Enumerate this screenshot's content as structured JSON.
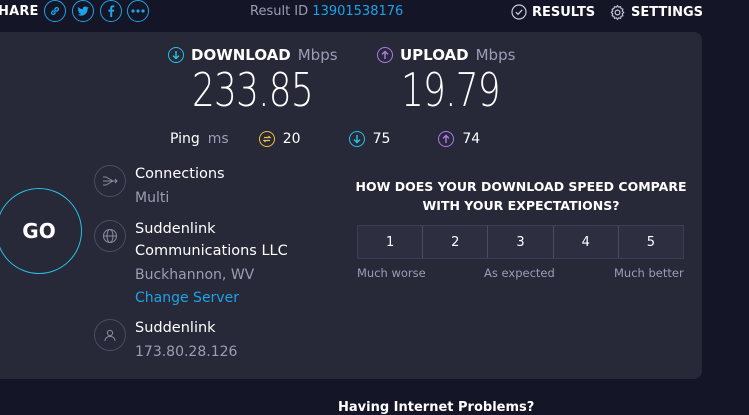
{
  "header": {
    "share_label": "HARE",
    "result_id_label": "Result ID",
    "result_id_value": "13901538176",
    "results_label": "RESULTS",
    "settings_label": "SETTINGS"
  },
  "download": {
    "label": "DOWNLOAD",
    "unit": "Mbps",
    "value": "233.85"
  },
  "upload": {
    "label": "UPLOAD",
    "unit": "Mbps",
    "value": "19.79"
  },
  "ping": {
    "label": "Ping",
    "unit": "ms",
    "idle": "20",
    "download": "75",
    "upload": "74"
  },
  "go_label": "GO",
  "connections": {
    "title": "Connections",
    "value": "Multi"
  },
  "server": {
    "name_line1": "Suddenlink",
    "name_line2": "Communications LLC",
    "location": "Buckhannon, WV",
    "change_link": "Change Server"
  },
  "isp": {
    "name": "Suddenlink",
    "ip": "173.80.28.126"
  },
  "survey": {
    "question_line1": "HOW DOES YOUR DOWNLOAD SPEED COMPARE",
    "question_line2": "WITH YOUR EXPECTATIONS?",
    "options": [
      "1",
      "2",
      "3",
      "4",
      "5"
    ],
    "low_label": "Much worse",
    "mid_label": "As expected",
    "high_label": "Much better"
  },
  "bottom_text": "Having Internet Problems?",
  "colors": {
    "background": "#141526",
    "panel": "#272838",
    "accent_blue": "#1ea3e5",
    "download_cyan": "#27c3e6",
    "upload_purple": "#b07ae6",
    "ping_yellow": "#f0c040",
    "muted_text": "#9b9eb5"
  }
}
